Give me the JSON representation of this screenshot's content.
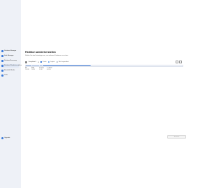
{
  "sidebar": {
    "items": [
      {
        "label": "Partition Manager",
        "active": false
      },
      {
        "label": "Disk Manager",
        "active": false
      },
      {
        "label": "Partition Recovery",
        "active": false
      },
      {
        "label": "Partition Wiederherstellen",
        "active": true
      },
      {
        "label": "Bootable Media",
        "active": false
      },
      {
        "label": "Tools",
        "active": false
      }
    ],
    "footer_label": "Upgrade"
  },
  "main": {
    "title": "Partition wiederherstellen",
    "subtitle": "Wählen Sie den Datenträger aus, um verlorene Partitionen zu suchen."
  },
  "disk": {
    "label": "Festplatte 1",
    "legend": [
      {
        "label": "Primär",
        "color": "#3b7ad9"
      },
      {
        "label": "Logisch",
        "color": "#7fb0f0"
      },
      {
        "label": "Nicht zugeordnet",
        "color": "#c9ced8"
      }
    ],
    "partitions": [
      {
        "name": "EFI",
        "size": "100 MB",
        "color": "#8aa9d8"
      },
      {
        "name": "MSR",
        "size": "16 MB",
        "color": "#a9c0e6"
      },
      {
        "name": "Partition",
        "size": "50 GB",
        "color": "#9fb9e3"
      },
      {
        "name": "C:\\ NTFS",
        "size": "409 GB",
        "color": "#3f7bd6"
      }
    ]
  },
  "buttons": {
    "scan_label": "Scannen"
  }
}
